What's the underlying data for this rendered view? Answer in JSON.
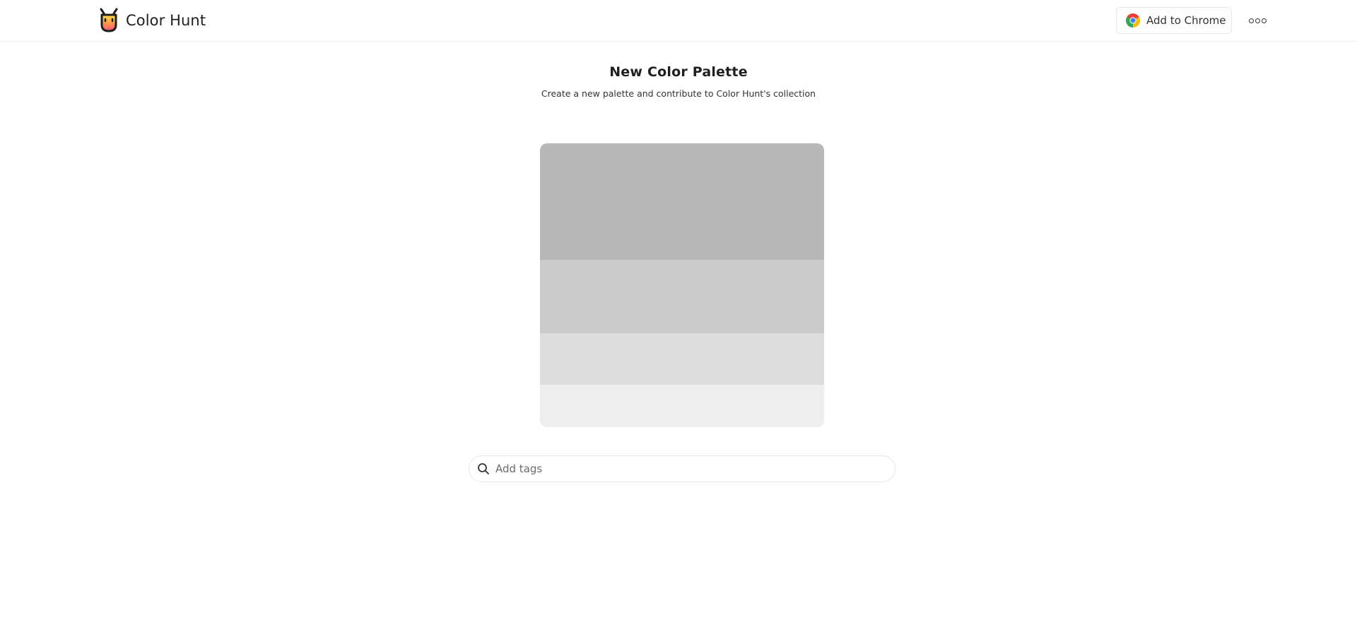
{
  "header": {
    "brand": "Color Hunt",
    "chrome_button_label": "Add to Chrome",
    "logo_icon": "color-hunt-cup-logo",
    "chrome_icon": "chrome-icon",
    "more_icon": "more-horizontal-icon"
  },
  "page": {
    "title": "New Color Palette",
    "subtitle": "Create a new palette and contribute to Color Hunt's collection"
  },
  "palette": {
    "swatches": [
      {
        "name": "swatch-1",
        "color": "#b8b8b8"
      },
      {
        "name": "swatch-2",
        "color": "#cbcbcb"
      },
      {
        "name": "swatch-3",
        "color": "#dddddd"
      },
      {
        "name": "swatch-4",
        "color": "#eeeeee"
      }
    ]
  },
  "tags": {
    "placeholder": "Add tags",
    "value": ""
  },
  "colors": {
    "text": "#1f1f1f",
    "border": "#e8e8e8",
    "background": "#ffffff"
  }
}
